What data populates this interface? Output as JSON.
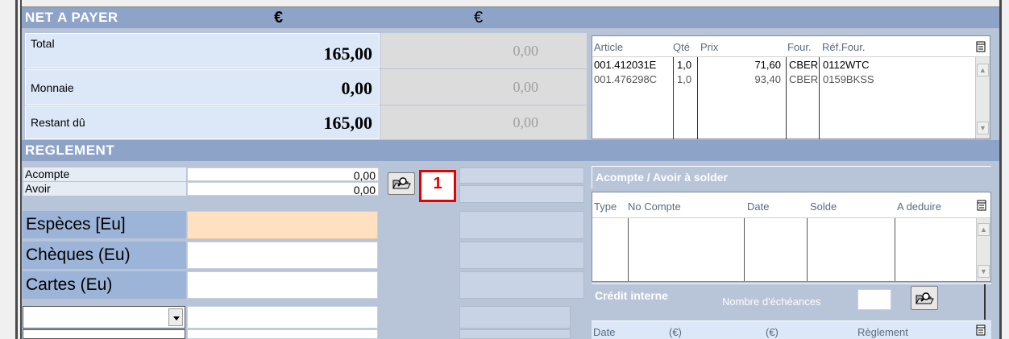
{
  "net": {
    "title": "NET A PAYER",
    "currency1": "€",
    "currency2": "€",
    "rows": [
      {
        "label": "Total",
        "value": "165,00",
        "value2": "0,00"
      },
      {
        "label": "Monnaie",
        "value": "0,00",
        "value2": "0,00"
      },
      {
        "label": "Restant dû",
        "value": "165,00",
        "value2": "0,00"
      }
    ]
  },
  "articles": {
    "headers": [
      "Article",
      "Qté",
      "Prix",
      "Four.",
      "Réf.Four."
    ],
    "rows": [
      {
        "article": "001.412031E",
        "qte": "1,0",
        "prix": "71,60",
        "four": "CBER",
        "ref": "0112WTC"
      },
      {
        "article": "001.476298C",
        "qte": "1,0",
        "prix": "93,40",
        "four": "CBER",
        "ref": "0159BKSS"
      }
    ]
  },
  "reglement": {
    "title": "REGLEMENT",
    "acompte_label": "Acompte",
    "acompte_value": "0,00",
    "avoir_label": "Avoir",
    "avoir_value": "0,00",
    "badge": "1",
    "especes_label": "Espèces [Eu]",
    "cheques_label": "Chèques (Eu)",
    "cartes_label": "Cartes (Eu)",
    "accent_color": "#ffe0c0"
  },
  "acompte_panel": {
    "title": "Acompte / Avoir à solder",
    "headers": [
      "Type",
      "No Compte",
      "Date",
      "Solde",
      "A deduire"
    ]
  },
  "credit": {
    "title": "Crédit interne",
    "echeances_label": "Nombre d'échéances",
    "headers": [
      "Date",
      "(€)",
      "(€)",
      "Règlement"
    ]
  }
}
